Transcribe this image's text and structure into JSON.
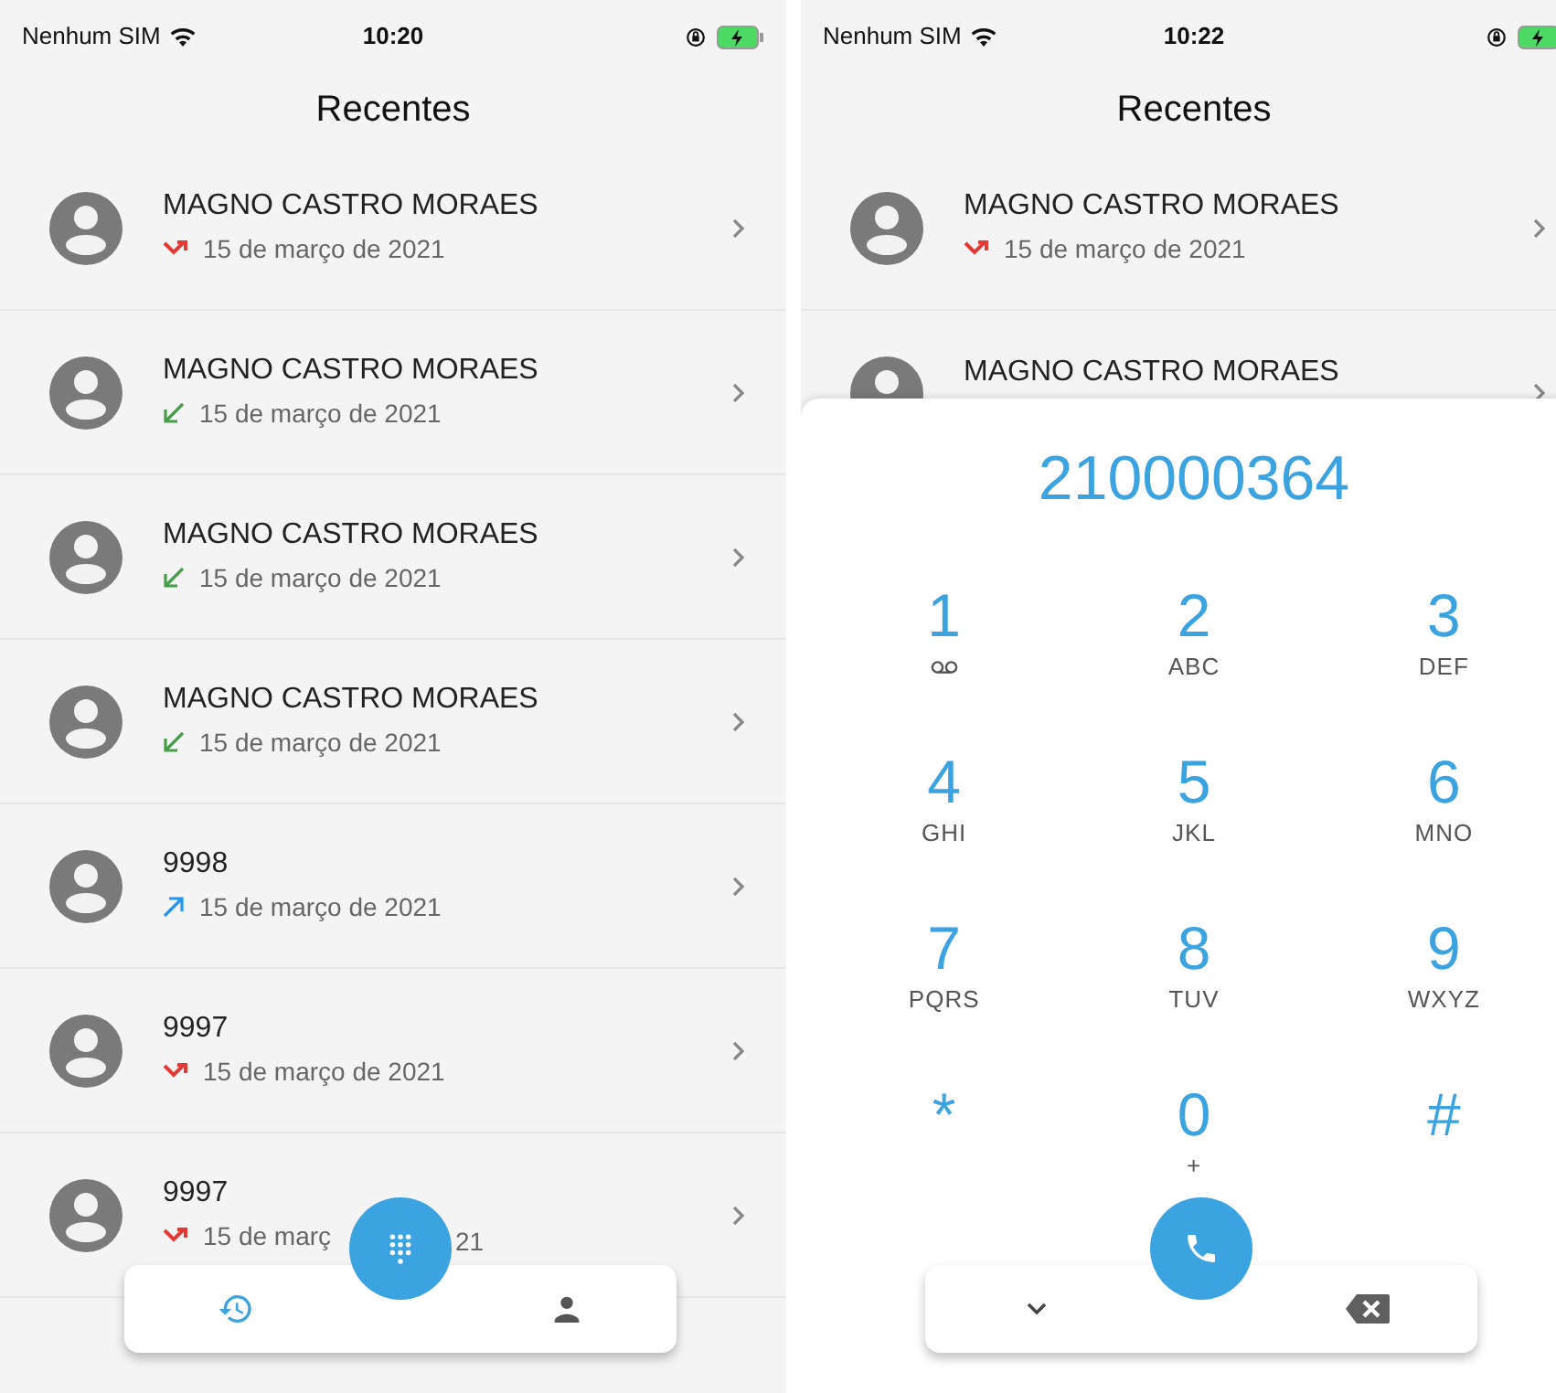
{
  "screens": [
    {
      "status_bar": {
        "carrier": "Nenhum SIM",
        "time": "10:20"
      },
      "title": "Recentes",
      "rows": [
        {
          "name": "MAGNO CASTRO MORAES",
          "kind": "missed",
          "date": "15 de março de 2021"
        },
        {
          "name": "MAGNO CASTRO MORAES",
          "kind": "incoming",
          "date": "15 de março de 2021"
        },
        {
          "name": "MAGNO CASTRO MORAES",
          "kind": "incoming",
          "date": "15 de março de 2021"
        },
        {
          "name": "MAGNO CASTRO MORAES",
          "kind": "incoming",
          "date": "15 de março de 2021"
        },
        {
          "name": "9998",
          "kind": "outgoing",
          "date": "15 de março de 2021"
        },
        {
          "name": "9997",
          "kind": "missed",
          "date": "15 de março de 2021"
        },
        {
          "name": "9997",
          "kind": "missed",
          "date": "15 de març",
          "date_tail": "21"
        }
      ],
      "bottom_nav": {
        "kind": "tabs",
        "tabs": [
          {
            "kind": "history",
            "selected": true
          },
          {
            "kind": "contacts",
            "selected": false
          }
        ]
      }
    },
    {
      "status_bar": {
        "carrier": "Nenhum SIM",
        "time": "10:22"
      },
      "title": "Recentes",
      "rows": [
        {
          "name": "MAGNO CASTRO MORAES",
          "kind": "missed",
          "date": "15 de março de 2021"
        },
        {
          "name": "MAGNO CASTRO MORAES"
        }
      ],
      "dialer": {
        "number": "210000364",
        "keys": [
          {
            "digit": "1",
            "kind": "voicemail"
          },
          {
            "digit": "2",
            "letters": "ABC"
          },
          {
            "digit": "3",
            "letters": "DEF"
          },
          {
            "digit": "4",
            "letters": "GHI"
          },
          {
            "digit": "5",
            "letters": "JKL"
          },
          {
            "digit": "6",
            "letters": "MNO"
          },
          {
            "digit": "7",
            "letters": "PQRS"
          },
          {
            "digit": "8",
            "letters": "TUV"
          },
          {
            "digit": "9",
            "letters": "WXYZ"
          },
          {
            "digit": "*"
          },
          {
            "digit": "0",
            "letters": "+"
          },
          {
            "digit": "#"
          }
        ]
      },
      "bottom_nav": {
        "kind": "dialer"
      }
    }
  ]
}
